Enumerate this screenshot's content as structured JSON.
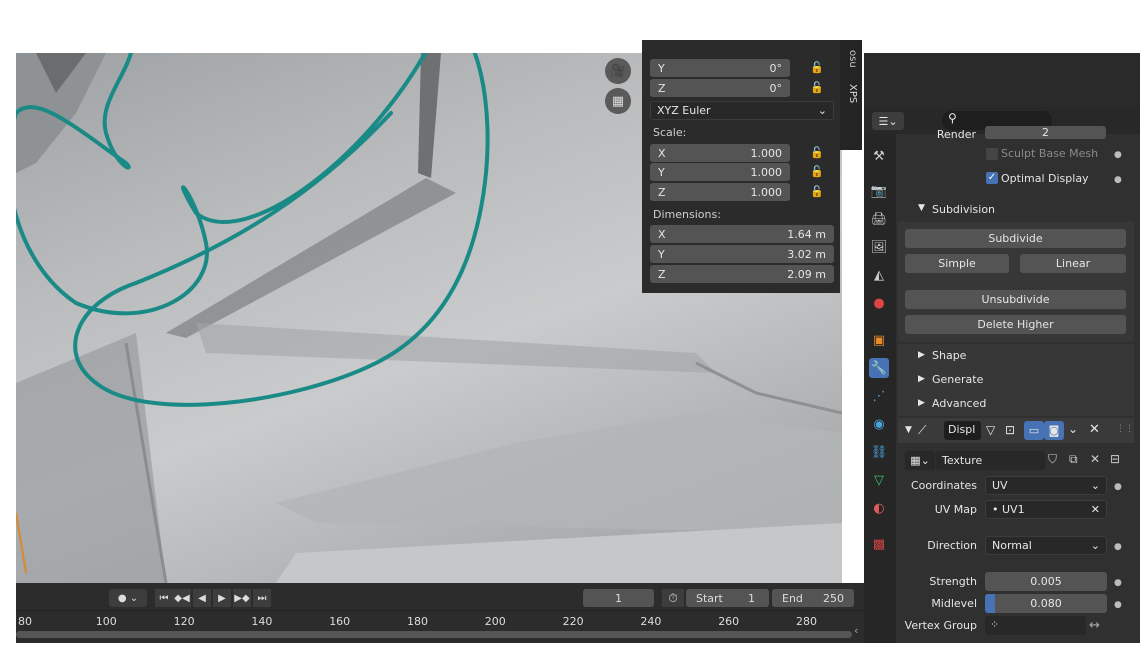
{
  "viewport": {
    "nav_camera_icon": "camera-icon",
    "nav_grid_icon": "grid-icon"
  },
  "npanel": {
    "rotation_y_label": "Y",
    "rotation_y_value": "0°",
    "rotation_z_label": "Z",
    "rotation_z_value": "0°",
    "rotation_mode": "XYZ Euler",
    "scale_label": "Scale:",
    "scale": [
      {
        "axis": "X",
        "value": "1.000"
      },
      {
        "axis": "Y",
        "value": "1.000"
      },
      {
        "axis": "Z",
        "value": "1.000"
      }
    ],
    "dimensions_label": "Dimensions:",
    "dimensions": [
      {
        "axis": "X",
        "value": "1.64 m"
      },
      {
        "axis": "Y",
        "value": "3.02 m"
      },
      {
        "axis": "Z",
        "value": "2.09 m"
      }
    ]
  },
  "side_tabs": {
    "xps": "XPS",
    "tab_partial": "osu"
  },
  "properties": {
    "render_label": "Render",
    "render_value": "2",
    "sculpt_base_mesh": "Sculpt Base Mesh",
    "optimal_display": "Optimal Display",
    "subdivision_header": "Subdivision",
    "subdivide_btn": "Subdivide",
    "simple_btn": "Simple",
    "linear_btn": "Linear",
    "unsubdivide_btn": "Unsubdivide",
    "delete_higher_btn": "Delete Higher",
    "shape_header": "Shape",
    "generate_header": "Generate",
    "advanced_header": "Advanced",
    "modifier_name": "Displ",
    "texture_name": "Texture",
    "coordinates_label": "Coordinates",
    "coordinates_value": "UV",
    "uvmap_label": "UV Map",
    "uvmap_value": "UV1",
    "direction_label": "Direction",
    "direction_value": "Normal",
    "strength_label": "Strength",
    "strength_value": "0.005",
    "midlevel_label": "Midlevel",
    "midlevel_value": "0.080",
    "midlevel_fraction": 0.08,
    "vertex_group_label": "Vertex Group"
  },
  "timeline": {
    "current_frame": "1",
    "start_label": "Start",
    "start_value": "1",
    "end_label": "End",
    "end_value": "250",
    "ticks": [
      "80",
      "100",
      "120",
      "140",
      "160",
      "180",
      "200",
      "220",
      "240",
      "260",
      "280"
    ]
  },
  "colors": {
    "annotation": "#1a8a86",
    "accent": "#4772b3"
  }
}
